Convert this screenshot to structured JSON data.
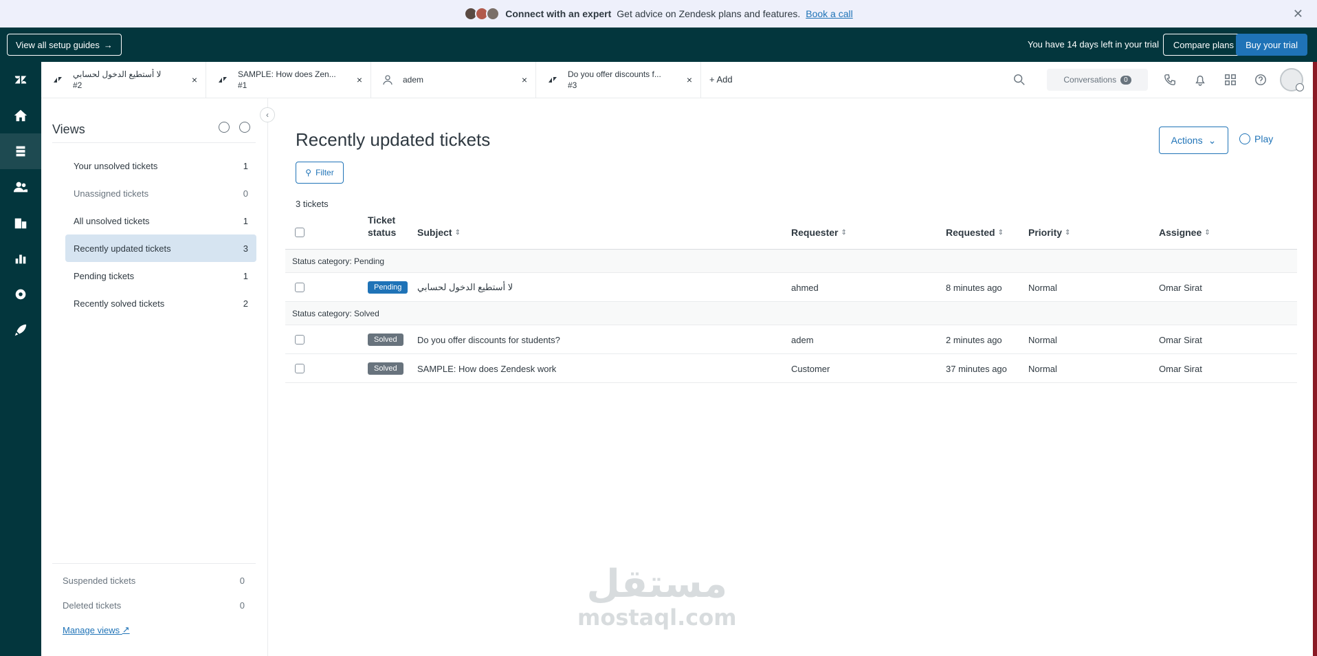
{
  "banner": {
    "headline": "Connect with an expert",
    "text": "Get advice on Zendesk plans and features.",
    "link": "Book a call",
    "avatar_colors": [
      "#5a4a42",
      "#b25a4c",
      "#7a6f68"
    ]
  },
  "trial": {
    "setup_label": "View all setup guides",
    "setup_arrow": "→",
    "days_text": "You have 14 days left in your trial",
    "compare_label": "Compare plans",
    "buy_label": "Buy your trial"
  },
  "tabs": [
    {
      "title": "لا أستطيع الدخول لحسابي",
      "sub": "#2",
      "icon": "ticket-icon"
    },
    {
      "title": "SAMPLE: How does Zen...",
      "sub": "#1",
      "icon": "ticket-icon"
    },
    {
      "title": "adem",
      "sub": "",
      "icon": "user-icon"
    },
    {
      "title": "Do you offer discounts f...",
      "sub": "#3",
      "icon": "ticket-icon"
    }
  ],
  "tab_close": "×",
  "add_tab": "+ Add",
  "conversations": {
    "label": "Conversations",
    "count": "0"
  },
  "views_panel": {
    "title": "Views",
    "items": [
      {
        "label": "Your unsolved tickets",
        "count": "1"
      },
      {
        "label": "Unassigned tickets",
        "count": "0"
      },
      {
        "label": "All unsolved tickets",
        "count": "1"
      },
      {
        "label": "Recently updated tickets",
        "count": "3"
      },
      {
        "label": "Pending tickets",
        "count": "1"
      },
      {
        "label": "Recently solved tickets",
        "count": "2"
      }
    ],
    "footer": [
      {
        "label": "Suspended tickets",
        "count": "0"
      },
      {
        "label": "Deleted tickets",
        "count": "0"
      }
    ],
    "manage": "Manage views"
  },
  "main": {
    "title": "Recently updated tickets",
    "actions": "Actions",
    "play": "Play",
    "filter": "Filter",
    "count": "3 tickets"
  },
  "table": {
    "headers": {
      "status_line1": "Ticket",
      "status_line2": "status",
      "subject": "Subject",
      "requester": "Requester",
      "requested": "Requested",
      "priority": "Priority",
      "assignee": "Assignee"
    },
    "groups": [
      {
        "label": "Status category: Pending",
        "rows": [
          {
            "status": "Pending",
            "subject": "لا أستطيع الدخول لحسابي",
            "requester": "ahmed",
            "requested": "8 minutes ago",
            "priority": "Normal",
            "assignee": "Omar Sirat"
          }
        ]
      },
      {
        "label": "Status category: Solved",
        "rows": [
          {
            "status": "Solved",
            "subject": "Do you offer discounts for students?",
            "requester": "adem",
            "requested": "2 minutes ago",
            "priority": "Normal",
            "assignee": "Omar Sirat"
          },
          {
            "status": "Solved",
            "subject": "SAMPLE: How does Zendesk work",
            "requester": "Customer",
            "requested": "37 minutes ago",
            "priority": "Normal",
            "assignee": "Omar Sirat"
          }
        ]
      }
    ]
  },
  "watermark": {
    "line1": "مستقل",
    "line2": "mostaql.com"
  },
  "colors": {
    "rail": "#03363d",
    "accent": "#1f73b7",
    "active_view": "#d6e4f1"
  }
}
